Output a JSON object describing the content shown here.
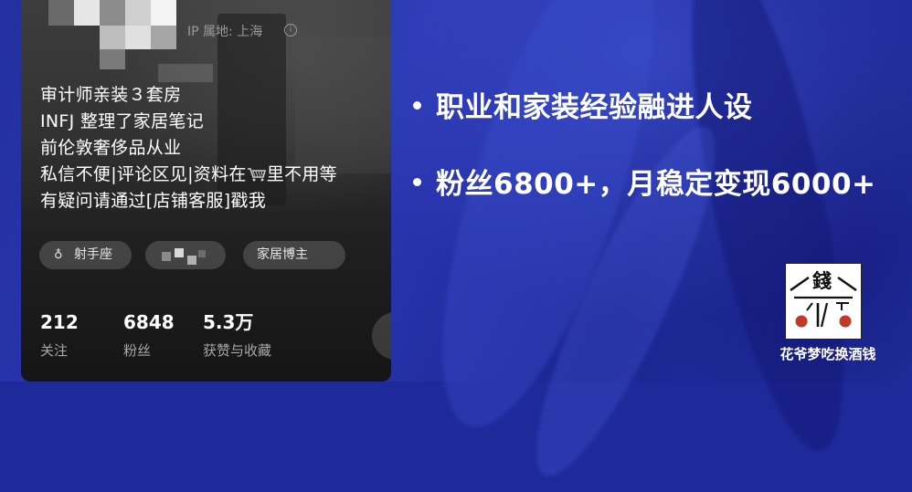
{
  "profile": {
    "ip_location": "IP 属地: 上海",
    "bio_lines": [
      "审计师亲装３套房",
      "INFJ 整理了家居笔记",
      "前伦敦奢侈品从业",
      "私信不便|评论区见|资料在",
      "里不用等",
      "有疑问请通过[店铺客服]戳我"
    ],
    "tags": {
      "zodiac_glyph": "♁",
      "zodiac": "射手座",
      "category": "家居博主"
    },
    "stats": [
      {
        "value": "212",
        "label": "关注"
      },
      {
        "value": "6848",
        "label": "粉丝"
      },
      {
        "value": "5.3万",
        "label": "获赞与收藏"
      }
    ]
  },
  "bullets": [
    "职业和家装经验融进人设",
    "粉丝6800+，月稳定变现6000+"
  ],
  "logo": {
    "glyph": "錢",
    "name": "花爷梦吃换酒钱",
    "dot_color": "#c0392b"
  },
  "icons": [
    "info-icon",
    "cart-icon",
    "zodiac-icon"
  ]
}
